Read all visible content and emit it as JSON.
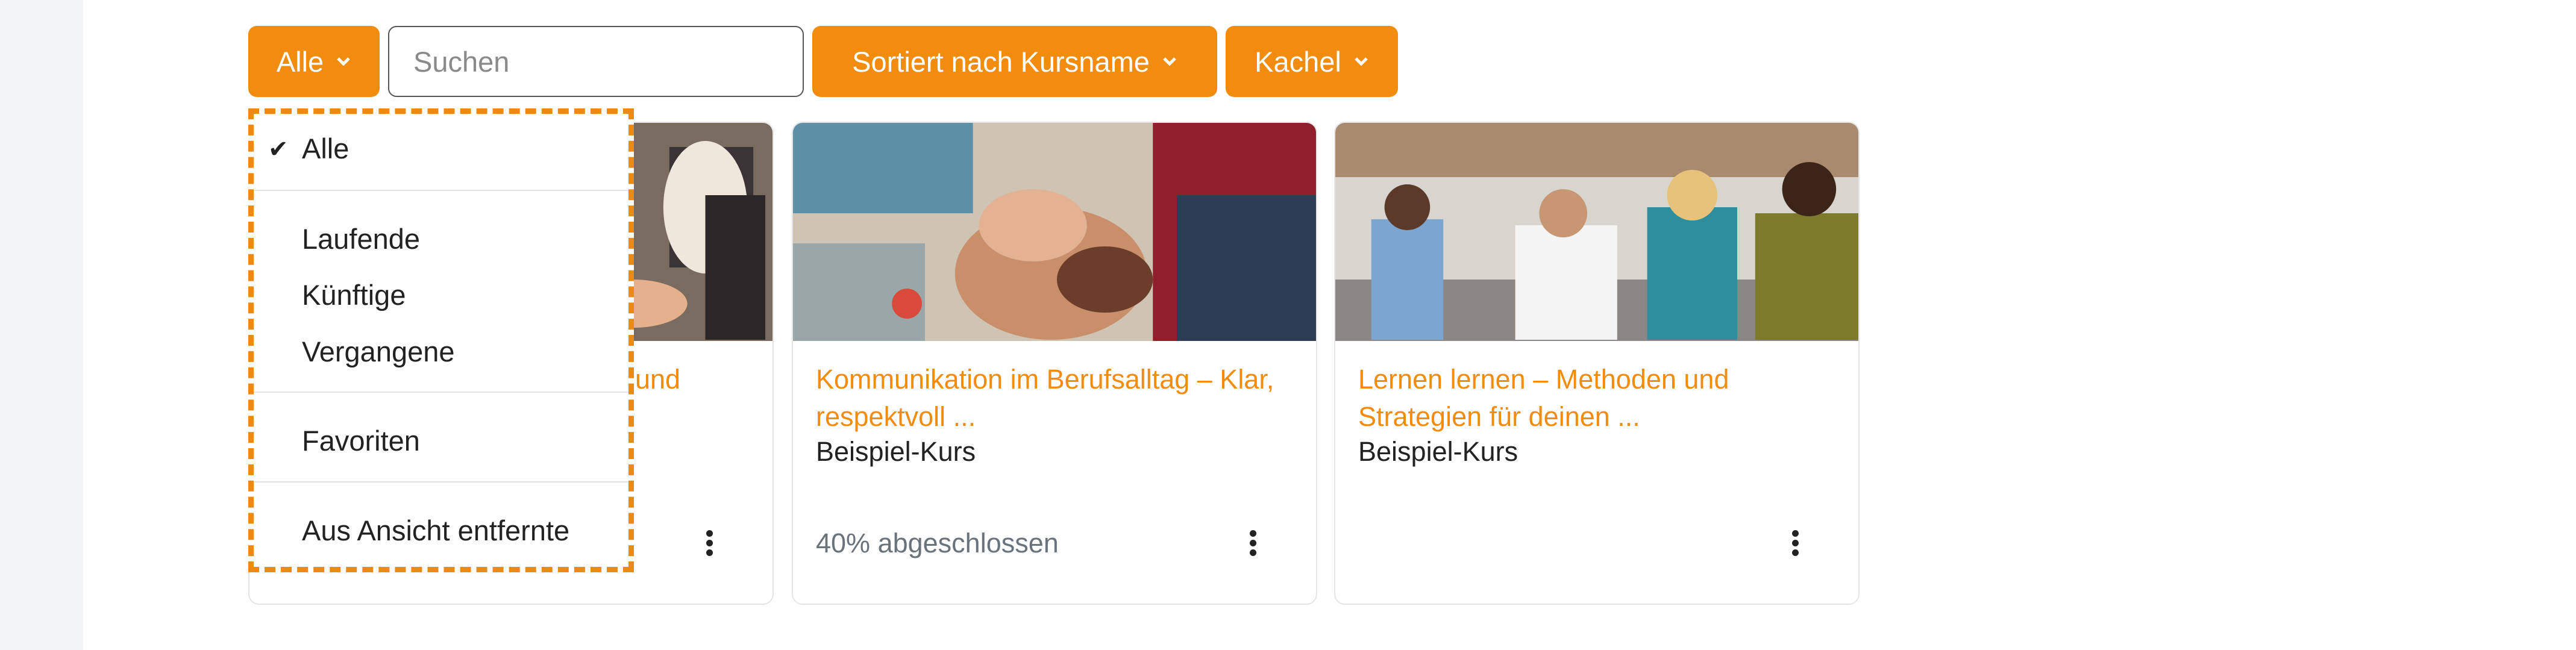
{
  "toolbar": {
    "filter_label": "Alle",
    "search_placeholder": "Suchen",
    "sort_label": "Sortiert nach Kursname",
    "view_label": "Kachel"
  },
  "colors": {
    "accent": "#f28c0f",
    "dropdown_outline": "#ec8a14"
  },
  "dropdown": {
    "selected": "Alle",
    "items": [
      "Alle",
      "Laufende",
      "Künftige",
      "Vergangene",
      "Favoriten",
      "Aus Ansicht entfernte"
    ]
  },
  "courses": [
    {
      "title_suffix": "und",
      "category": "",
      "progress": ""
    },
    {
      "title": "Kommunikation im Berufsalltag – Klar, respektvoll ...",
      "category": "Beispiel-Kurs",
      "progress": "40% abgeschlossen"
    },
    {
      "title": "Lernen lernen – Methoden und Strategien für deinen ...",
      "category": "Beispiel-Kurs",
      "progress": ""
    }
  ]
}
